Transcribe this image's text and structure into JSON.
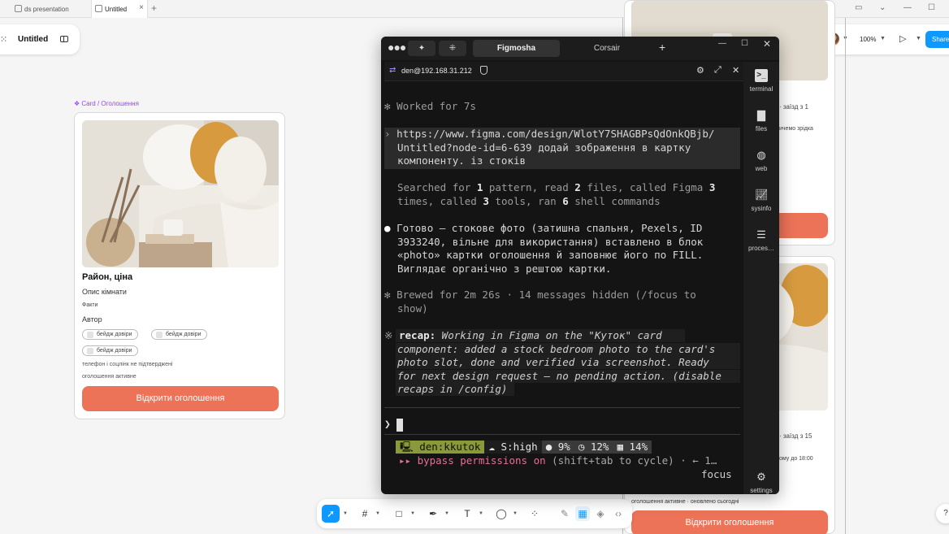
{
  "tabs": [
    {
      "label": "ds presentation"
    },
    {
      "label": "Untitled"
    }
  ],
  "header": {
    "file_title": "Untitled",
    "zoom": "100%",
    "share_label": "Share"
  },
  "card": {
    "component_label": "Card / Оголошення",
    "title": "Район, ціна",
    "description": "Опис кімнати",
    "facts": "Факти",
    "author": "Автор",
    "badges": [
      "бейдж довіри",
      "бейдж довіри",
      "бейдж довіри"
    ],
    "phone_note": "телефон і соцлінк не підтверджені",
    "active_note": "оголошення активне",
    "cta": "Відкрити оголошення"
  },
  "right_cards": {
    "top_text_1": "· заїзд з 1",
    "top_text_2": "ичемо зрідка",
    "bottom_text_1": "· заїзд з 15",
    "bottom_text_2": "ому до 18:00",
    "bottom_text_3": "оголошення активне · оновлено сьогодні",
    "cta": "Відкрити оголошення"
  },
  "terminal": {
    "tab_active": "Figmosha",
    "tab_other": "Corsair",
    "host": "den@192.168.31.212",
    "lines": {
      "worked": "Worked for 7s",
      "user_1": "https://www.figma.com/design/WlotY7SHAGBPsQdOnkQBjb/",
      "user_2": "Untitled?node-id=6-639 додай зображення в картку",
      "user_3": "компоненту. із стоків",
      "searched_1a": "Searched for ",
      "searched_1b": "1",
      "searched_1c": " pattern, read ",
      "searched_1d": "2",
      "searched_1e": " files, called Figma ",
      "searched_1f": "3",
      "searched_2a": "times, called ",
      "searched_2b": "3",
      "searched_2c": " tools, ran ",
      "searched_2d": "6",
      "searched_2e": " shell commands",
      "done_1": "Готово — стокове фото (затишна спальня, Pexels, ID",
      "done_2": "3933240, вільне для використання) вставлено в блок",
      "done_3": "«photo» картки оголошення й заповнює його по FILL.",
      "done_4": "Виглядає органічно з рештою картки.",
      "brewed_1": "Brewed for 2m 26s · 14 messages hidden (/focus to",
      "brewed_2": "show)",
      "recap_label": "recap:",
      "recap_1": " Working in Figma on the \"Куток\" card",
      "recap_2": "component: added a stock bedroom photo to the card's",
      "recap_3": "photo slot, done and verified via screenshot. Ready",
      "recap_4": "for next design request — no pending action. (disable",
      "recap_5": "recaps in /config)"
    },
    "status": {
      "user": "den:kkutok",
      "effort": "S:high",
      "cpu": "9%",
      "time": "12%",
      "mem": "14%"
    },
    "bypass_label": "bypass permissions on",
    "bypass_hint": " (shift+tab to cycle) · ← 1…",
    "focus": "focus",
    "sidebar": [
      "terminal",
      "files",
      "web",
      "sysinfo",
      "proces…",
      "settings"
    ]
  },
  "colors": {
    "accent": "#0d99ff",
    "cta": "#ec7358",
    "component_purple": "#9747ff"
  }
}
